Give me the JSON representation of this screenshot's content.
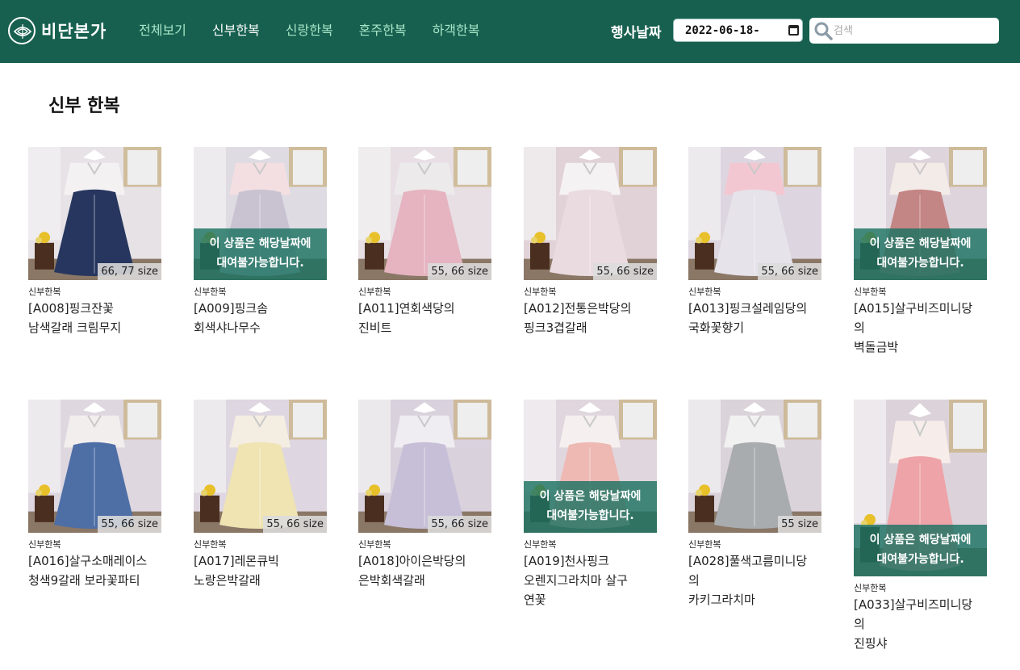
{
  "header": {
    "brand": "비단본가",
    "nav": [
      "전체보기",
      "신부한복",
      "신랑한복",
      "혼주한복",
      "하객한복"
    ],
    "active_nav": 1,
    "event_date_label": "행사날짜",
    "event_date_value": "2022-06-18",
    "search_placeholder": "검색"
  },
  "main": {
    "title": "신부 한복"
  },
  "products": [
    {
      "category": "신부한복",
      "name": "[A008]핑크잔꽃\n남색갈래 크림무지",
      "size": "66, 77 size",
      "overlay": "",
      "colors": {
        "top": "#f4f1f3",
        "skirt": "#26365e",
        "wall": "#e6e2e6"
      }
    },
    {
      "category": "신부한복",
      "name": "[A009]핑크솜\n회색샤나무수",
      "size": "",
      "overlay": "이 상품은 해당날짜에\n대여불가능합니다.",
      "colors": {
        "top": "#f3dfe2",
        "skirt": "#c9c3d1",
        "wall": "#dedbe2"
      }
    },
    {
      "category": "신부한복",
      "name": "[A011]연회색당의\n진비트",
      "size": "55, 66 size",
      "overlay": "",
      "colors": {
        "top": "#eceaea",
        "skirt": "#e5b4c0",
        "wall": "#e7dfe4"
      }
    },
    {
      "category": "신부한복",
      "name": "[A012]전통은박당의\n핑크3겹갈래",
      "size": "55, 66 size",
      "overlay": "",
      "colors": {
        "top": "#f4f2f2",
        "skirt": "#eadbe0",
        "wall": "#e1d2d8"
      }
    },
    {
      "category": "신부한복",
      "name": "[A013]핑크설레임당의\n국화꽃향기",
      "size": "55, 66 size",
      "overlay": "",
      "colors": {
        "top": "#f2c7d2",
        "skirt": "#e6e3ea",
        "wall": "#ddd6e0"
      }
    },
    {
      "category": "신부한복",
      "name": "[A015]살구비즈미니당\n의\n벽돌금박",
      "size": "",
      "overlay": "이 상품은 해당날짜에\n대여불가능합니다.",
      "colors": {
        "top": "#f3ebe8",
        "skirt": "#c48585",
        "wall": "#ddd4dc"
      }
    },
    {
      "category": "신부한복",
      "name": "[A016]살구소매레이스\n청색9갈래 보라꽃파티",
      "size": "55, 66 size",
      "overlay": "",
      "colors": {
        "top": "#f3eeee",
        "skirt": "#4e6ea6",
        "wall": "#ded7e0"
      }
    },
    {
      "category": "신부한복",
      "name": "[A017]레몬큐빅\n노랑은박갈래",
      "size": "55, 66 size",
      "overlay": "",
      "colors": {
        "top": "#f4ede2",
        "skirt": "#efe4b2",
        "wall": "#ded6e0"
      }
    },
    {
      "category": "신부한복",
      "name": "[A018]아이은박당의\n은박회색갈래",
      "size": "55, 66 size",
      "overlay": "",
      "colors": {
        "top": "#efedf1",
        "skirt": "#c7bfd7",
        "wall": "#d9d2dd"
      }
    },
    {
      "category": "신부한복",
      "name": "[A019]천사핑크\n오렌지그라치마 살구\n연꽃",
      "size": "",
      "overlay": "이 상품은 해당날짜에\n대여불가능합니다.",
      "colors": {
        "top": "#f5f0ef",
        "skirt": "#eeb8b3",
        "wall": "#e0d6dd"
      }
    },
    {
      "category": "신부한복",
      "name": "[A028]풀색고름미니당\n의\n카키그라치마",
      "size": "55 size",
      "overlay": "",
      "colors": {
        "top": "#f1f1f1",
        "skirt": "#a9acae",
        "wall": "#dbd3da"
      }
    },
    {
      "category": "신부한복",
      "name": "[A033]살구비즈미니당\n의\n진핑샤",
      "size": "",
      "overlay": "이 상품은 해당날짜에\n대여불가능합니다.",
      "colors": {
        "top": "#f6ecea",
        "skirt": "#eea3a8",
        "wall": "#dcd3da"
      }
    }
  ]
}
